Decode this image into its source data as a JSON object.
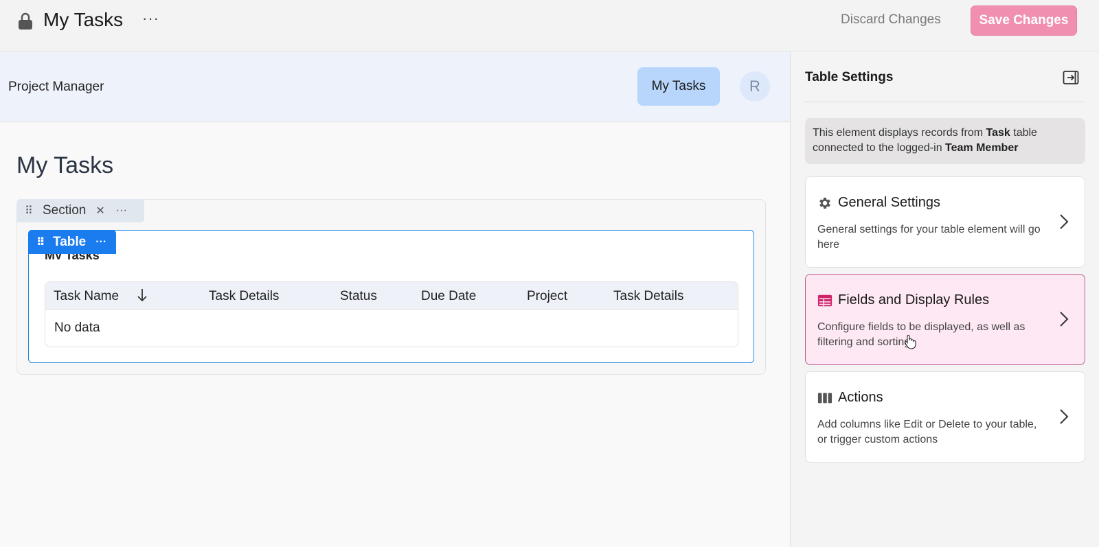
{
  "topbar": {
    "title": "My Tasks",
    "more_label": "···",
    "discard_label": "Discard Changes",
    "save_label": "Save Changes"
  },
  "app_header": {
    "brand": "Project Manager",
    "nav_tab": "My Tasks",
    "avatar_initial": "R"
  },
  "canvas": {
    "page_title": "My Tasks",
    "section_tag": {
      "label": "Section",
      "dots": "···"
    },
    "table_tag": {
      "label": "Table",
      "dots": "···"
    },
    "table_heading": "My Tasks",
    "columns": [
      "Task Name",
      "Task Details",
      "Status",
      "Due Date",
      "Project",
      "Task Details"
    ],
    "empty_text": "No data"
  },
  "panel": {
    "title": "Table Settings",
    "info_parts": [
      "This element displays records from ",
      "Task",
      " table connected to the logged-in ",
      "Team Member"
    ],
    "cards": [
      {
        "title": "General Settings",
        "desc": "General settings for your table element will go here",
        "icon": "gear-icon"
      },
      {
        "title": "Fields and Display Rules",
        "desc": "Configure fields to be displayed, as well as filtering and sorting",
        "icon": "table-icon"
      },
      {
        "title": "Actions",
        "desc": "Add columns like Edit or Delete to your table, or trigger custom actions",
        "icon": "columns-icon"
      }
    ]
  },
  "colors": {
    "accent_blue": "#1b7cf0",
    "save_pink": "#f08fb0",
    "active_card_bg": "#fde8f3",
    "active_card_border": "#c05b8e",
    "table_icon": "#d0246a"
  }
}
